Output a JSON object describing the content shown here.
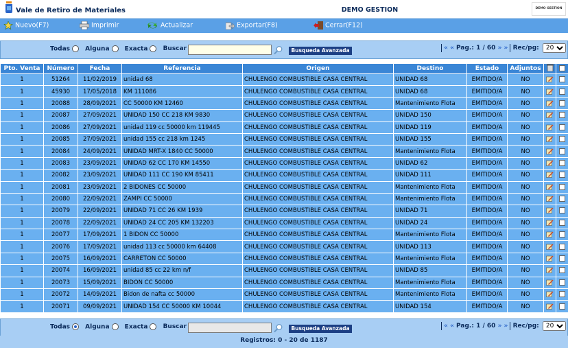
{
  "header": {
    "app_title": "Vale de Retiro de Materiales",
    "company": "DEMO GESTION",
    "company_logo_text": "DEMO GESTION"
  },
  "toolbar": {
    "new_label": "Nuevo(F7)",
    "print_label": "Imprimir",
    "refresh_label": "Actualizar",
    "export_label": "Exportar(F8)",
    "close_label": "Cerrar(F12)"
  },
  "search": {
    "all_label": "Todas",
    "any_label": "Alguna",
    "exact_label": "Exacta",
    "search_label": "Buscar",
    "value": "",
    "advanced_label": "Busqueda Avanzada",
    "top_selected": "none",
    "bottom_selected": "Todas"
  },
  "pager": {
    "nav_prev": "« «",
    "page_label": "Pag.:",
    "page_value": "1 / 60",
    "nav_next": "» »",
    "per_page_label": "Rec/pg:",
    "per_page_value": "20"
  },
  "table": {
    "columns": [
      "Pto. Venta",
      "Número",
      "Fecha",
      "Referencia",
      "Origen",
      "Destino",
      "Estado",
      "Adjuntos"
    ],
    "rows": [
      [
        "1",
        "51264",
        "11/02/2019",
        "unidad 68",
        "CHULENGO COMBUSTIBLE CASA CENTRAL",
        "UNIDAD 68",
        "EMITIDO/A",
        "NO"
      ],
      [
        "1",
        "45930",
        "17/05/2018",
        "KM 111086",
        "CHULENGO COMBUSTIBLE CASA CENTRAL",
        "UNIDAD 68",
        "EMITIDO/A",
        "NO"
      ],
      [
        "1",
        "20088",
        "28/09/2021",
        "CC 50000 KM 12460",
        "CHULENGO COMBUSTIBLE CASA CENTRAL",
        "Mantenimiento Flota",
        "EMITIDO/A",
        "NO"
      ],
      [
        "1",
        "20087",
        "27/09/2021",
        "UNIDAD 150 CC 218 KM 9830",
        "CHULENGO COMBUSTIBLE CASA CENTRAL",
        "UNIDAD 150",
        "EMITIDO/A",
        "NO"
      ],
      [
        "1",
        "20086",
        "27/09/2021",
        "unidad 119 cc 50000 km 119445",
        "CHULENGO COMBUSTIBLE CASA CENTRAL",
        "UNIDAD 119",
        "EMITIDO/A",
        "NO"
      ],
      [
        "1",
        "20085",
        "27/09/2021",
        "unidad 155 cc 218 km 1245",
        "CHULENGO COMBUSTIBLE CASA CENTRAL",
        "UNIDAD 155",
        "EMITIDO/A",
        "NO"
      ],
      [
        "1",
        "20084",
        "24/09/2021",
        "UNIDAD MRT-X 1840 CC 50000",
        "CHULENGO COMBUSTIBLE CASA CENTRAL",
        "Mantenimiento Flota",
        "EMITIDO/A",
        "NO"
      ],
      [
        "1",
        "20083",
        "23/09/2021",
        "UNIDAD 62 CC 170 KM 14550",
        "CHULENGO COMBUSTIBLE CASA CENTRAL",
        "UNIDAD 62",
        "EMITIDO/A",
        "NO"
      ],
      [
        "1",
        "20082",
        "23/09/2021",
        "UNIDAD 111 CC 190 KM 85411",
        "CHULENGO COMBUSTIBLE CASA CENTRAL",
        "UNIDAD 111",
        "EMITIDO/A",
        "NO"
      ],
      [
        "1",
        "20081",
        "23/09/2021",
        "2 BIDONES CC 50000",
        "CHULENGO COMBUSTIBLE CASA CENTRAL",
        "Mantenimiento Flota",
        "EMITIDO/A",
        "NO"
      ],
      [
        "1",
        "20080",
        "22/09/2021",
        "ZAMPI CC 50000",
        "CHULENGO COMBUSTIBLE CASA CENTRAL",
        "Mantenimiento Flota",
        "EMITIDO/A",
        "NO"
      ],
      [
        "1",
        "20079",
        "22/09/2021",
        "UNIDAD 71 CC 26 KM 1939",
        "CHULENGO COMBUSTIBLE CASA CENTRAL",
        "UNIDAD 71",
        "EMITIDO/A",
        "NO"
      ],
      [
        "1",
        "20078",
        "22/09/2021",
        "UNIDAD 24 CC 205 KM 132203",
        "CHULENGO COMBUSTIBLE CASA CENTRAL",
        "UNIDAD 24",
        "EMITIDO/A",
        "NO"
      ],
      [
        "1",
        "20077",
        "17/09/2021",
        "1 BIDON CC 50000",
        "CHULENGO COMBUSTIBLE CASA CENTRAL",
        "Mantenimiento Flota",
        "EMITIDO/A",
        "NO"
      ],
      [
        "1",
        "20076",
        "17/09/2021",
        "unidad 113 cc 50000 km 64408",
        "CHULENGO COMBUSTIBLE CASA CENTRAL",
        "UNIDAD 113",
        "EMITIDO/A",
        "NO"
      ],
      [
        "1",
        "20075",
        "16/09/2021",
        "CARRETON CC 50000",
        "CHULENGO COMBUSTIBLE CASA CENTRAL",
        "Mantenimiento Flota",
        "EMITIDO/A",
        "NO"
      ],
      [
        "1",
        "20074",
        "16/09/2021",
        "unidad 85 cc 22 km n/f",
        "CHULENGO COMBUSTIBLE CASA CENTRAL",
        "UNIDAD 85",
        "EMITIDO/A",
        "NO"
      ],
      [
        "1",
        "20073",
        "15/09/2021",
        "BIDON CC 50000",
        "CHULENGO COMBUSTIBLE CASA CENTRAL",
        "Mantenimiento Flota",
        "EMITIDO/A",
        "NO"
      ],
      [
        "1",
        "20072",
        "14/09/2021",
        "Bidon de nafta cc 50000",
        "CHULENGO COMBUSTIBLE CASA CENTRAL",
        "Mantenimiento Flota",
        "EMITIDO/A",
        "NO"
      ],
      [
        "1",
        "20071",
        "09/09/2021",
        "UNIDAD 154 CC 50000 KM 10044",
        "CHULENGO COMBUSTIBLE CASA CENTRAL",
        "UNIDAD 154",
        "EMITIDO/A",
        "NO"
      ]
    ]
  },
  "footer": {
    "records_label": "Registros: 0 - 20 de 1187"
  },
  "icons": {
    "app_logo": "jar-icon",
    "new": "star-icon",
    "print": "printer-icon",
    "refresh": "refresh-icon",
    "export": "export-icon",
    "close": "exit-door-icon",
    "search": "magnifier-icon",
    "delete_column": "trash-icon",
    "edit_row": "edit-pencil-icon"
  },
  "colors": {
    "toolbar_bg": "#5aa0e6",
    "searchbar_bg": "#a8cef4",
    "header_row_bg": "#3a86d6",
    "row_bg": "#6ab0f0",
    "advanced_button_bg": "#1c3f84"
  }
}
